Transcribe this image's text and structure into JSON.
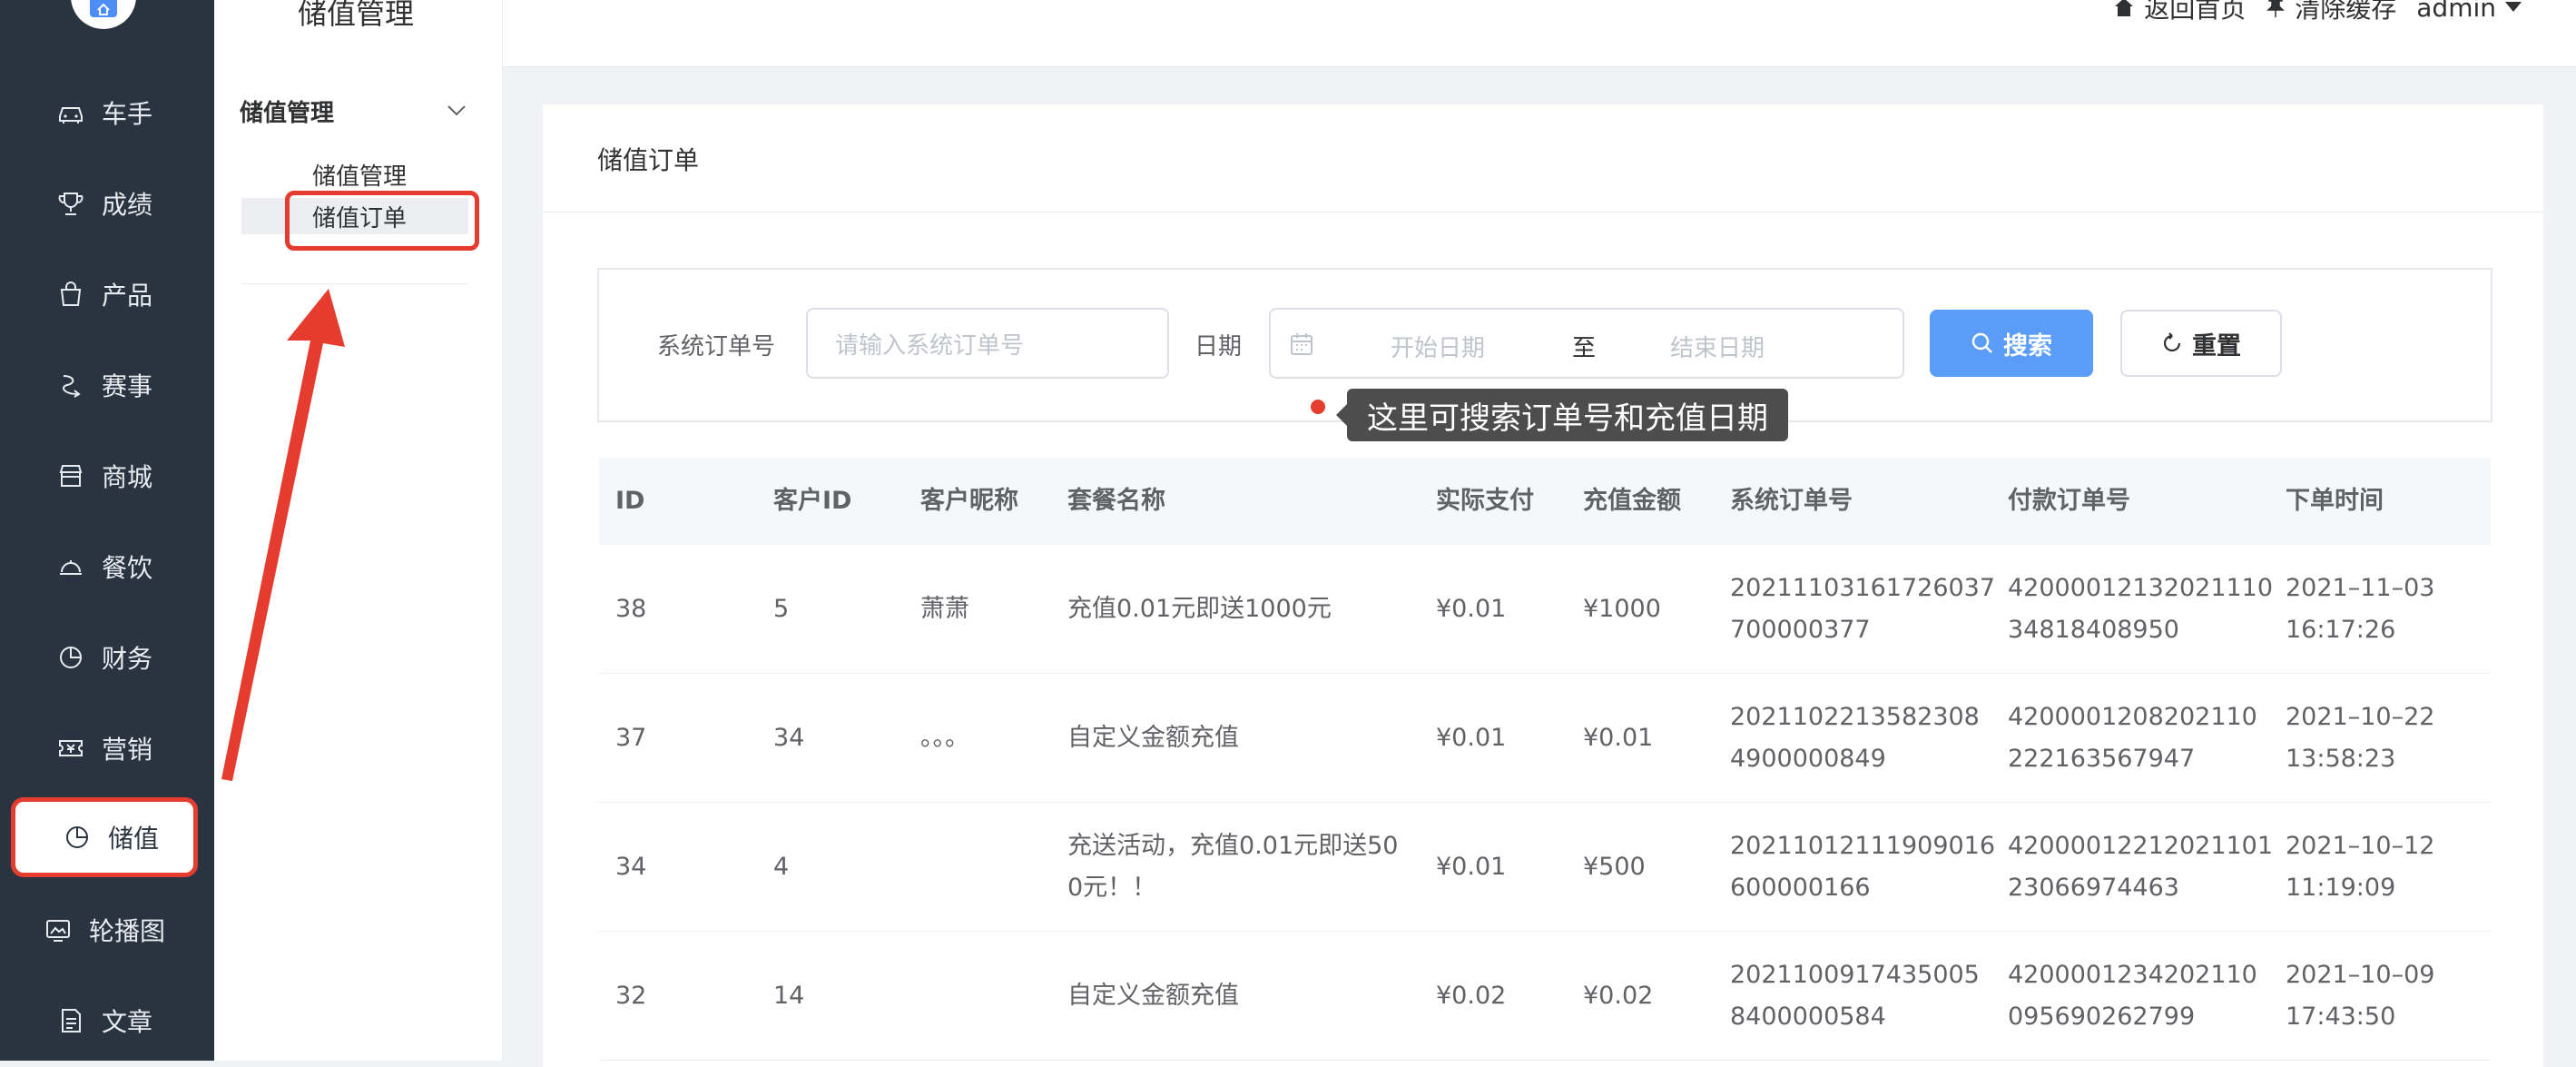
{
  "colors": {
    "sidebar_bg": "#2a3441",
    "primary": "#5a9cf8",
    "annotation_red": "#e53c2f"
  },
  "sidebar": {
    "items": [
      {
        "label": "车手",
        "icon": "car-icon"
      },
      {
        "label": "成绩",
        "icon": "trophy-icon"
      },
      {
        "label": "产品",
        "icon": "bag-icon"
      },
      {
        "label": "赛事",
        "icon": "race-icon"
      },
      {
        "label": "商城",
        "icon": "store-icon"
      },
      {
        "label": "餐饮",
        "icon": "dish-icon"
      },
      {
        "label": "财务",
        "icon": "pie-chart-icon"
      },
      {
        "label": "营销",
        "icon": "ticket-icon"
      },
      {
        "label": "储值",
        "icon": "pie-chart-icon",
        "active": true
      },
      {
        "label": "轮播图",
        "icon": "carousel-icon"
      },
      {
        "label": "文章",
        "icon": "document-icon"
      }
    ]
  },
  "submenu": {
    "title": "储值管理",
    "group": "储值管理",
    "items": [
      {
        "label": "储值管理"
      },
      {
        "label": "储值订单",
        "active": true
      }
    ]
  },
  "header": {
    "home": "返回首页",
    "clear_cache": "清除缓存",
    "user": "admin"
  },
  "card": {
    "title": "储值订单"
  },
  "search": {
    "order_label": "系统订单号",
    "order_placeholder": "请输入系统订单号",
    "date_label": "日期",
    "start_placeholder": "开始日期",
    "separator": "至",
    "end_placeholder": "结束日期",
    "search_button": "搜索",
    "reset_button": "重置"
  },
  "annotation": {
    "tooltip": "这里可搜索订单号和充值日期"
  },
  "table": {
    "columns": [
      "ID",
      "客户ID",
      "客户昵称",
      "套餐名称",
      "实际支付",
      "充值金额",
      "系统订单号",
      "付款订单号",
      "下单时间"
    ],
    "rows": [
      [
        "38",
        "5",
        "萧萧",
        "充值0.01元即送1000元",
        "¥0.01",
        "¥1000",
        "20211103161726037\n700000377",
        "42000012132021110\n34818408950",
        "2021–11–03\n16:17:26"
      ],
      [
        "37",
        "34",
        "。。。",
        "自定义金额充值",
        "¥0.01",
        "¥0.01",
        "2021102213582308\n4900000849",
        "4200001208202110\n222163567947",
        "2021–10–22\n13:58:23"
      ],
      [
        "34",
        "4",
        "",
        "充送活动，充值0.01元即送50\n0元！！",
        "¥0.01",
        "¥500",
        "20211012111909016\n600000166",
        "42000012212021101\n23066974463",
        "2021–10–12\n11:19:09"
      ],
      [
        "32",
        "14",
        "",
        "自定义金额充值",
        "¥0.02",
        "¥0.02",
        "2021100917435005\n8400000584",
        "4200001234202110\n095690262799",
        "2021–10–09\n17:43:50"
      ]
    ]
  }
}
